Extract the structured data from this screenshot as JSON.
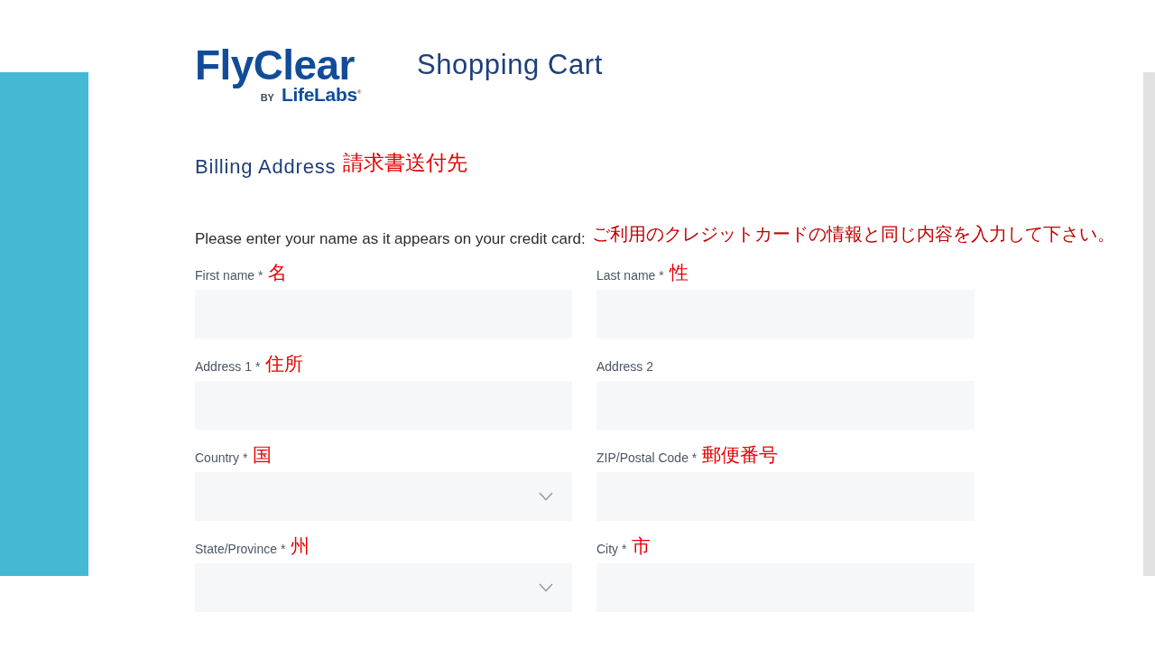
{
  "header": {
    "logo": {
      "wordmark": "FlyClear",
      "byline": "BY",
      "partner": "LifeLabs$^{®}$"
    },
    "title": "Shopping Cart"
  },
  "billing": {
    "heading": "Billing Address",
    "heading_note": "請求書送付先",
    "instruction": "Please enter your name as it appears on your credit card:",
    "instruction_note": "ご利用のクレジットカードの情報と同じ内容を入力して下さい。",
    "fields": [
      {
        "label": "First name *",
        "note": "名",
        "kind": "text"
      },
      {
        "label": "Last name *",
        "note": "性",
        "kind": "text"
      },
      {
        "label": "Address 1 *",
        "note": "住所",
        "kind": "text"
      },
      {
        "label": "Address 2",
        "kind": "text"
      },
      {
        "label": "Country *",
        "note": "国",
        "kind": "select"
      },
      {
        "label": "ZIP/Postal Code *",
        "note": "郵便番号",
        "kind": "text"
      },
      {
        "label": "State/Province *",
        "note": "州",
        "kind": "select"
      },
      {
        "label": "City *",
        "note": "市",
        "kind": "text"
      }
    ]
  }
}
